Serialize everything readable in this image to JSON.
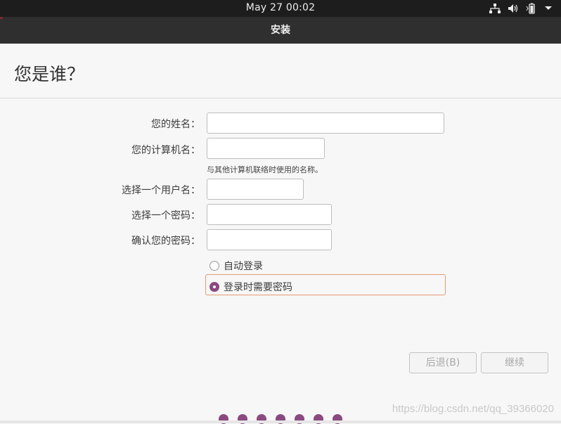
{
  "topbar": {
    "clock": "May 27  00:02",
    "icons": [
      "network-icon",
      "volume-icon",
      "battery-icon",
      "system-menu-arrow-icon"
    ]
  },
  "window": {
    "title": "安装"
  },
  "page": {
    "title": "您是谁？"
  },
  "form": {
    "name_label": "您的姓名：",
    "name_value": "",
    "computer_label": "您的计算机名：",
    "computer_value": "",
    "computer_hint": "与其他计算机联络时使用的名称。",
    "username_label": "选择一个用户名：",
    "username_value": "",
    "password_label": "选择一个密码：",
    "password_value": "",
    "confirm_label": "确认您的密码：",
    "confirm_value": ""
  },
  "login": {
    "options": [
      {
        "label": "自动登录",
        "selected": false
      },
      {
        "label": "登录时需要密码",
        "selected": true
      }
    ]
  },
  "buttons": {
    "back": "后退(B)",
    "continue": "继续"
  },
  "progress": {
    "total_steps": 7
  },
  "watermark": "https://blog.csdn.net/qq_39366020",
  "colors": {
    "accent": "#8a4a80",
    "focus": "#e39a73",
    "topbar": "#1d1d1d",
    "titlebar": "#2f2f2f"
  }
}
